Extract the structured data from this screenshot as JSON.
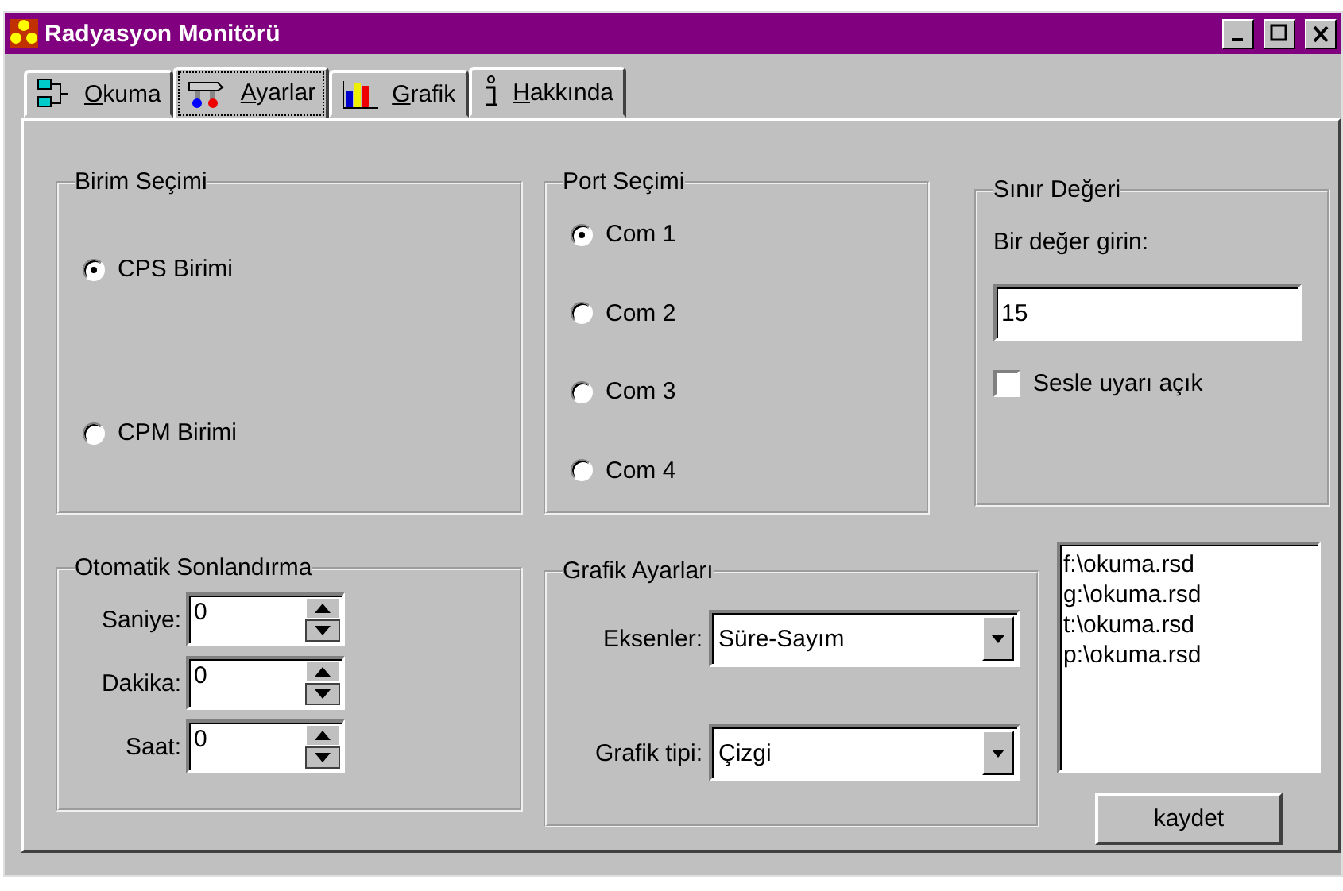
{
  "window": {
    "title": "Radyasyon Monitörü"
  },
  "tabs": [
    {
      "label": "Okuma",
      "selected": false,
      "kind": "reading"
    },
    {
      "label": "Ayarlar",
      "selected": true,
      "kind": "settings"
    },
    {
      "label": "Grafik",
      "selected": false,
      "kind": "chart"
    },
    {
      "label": "Hakkında",
      "selected": false,
      "kind": "info"
    }
  ],
  "unit_group": {
    "title": "Birim Seçimi",
    "options": [
      {
        "label": "CPS Birimi",
        "selected": true
      },
      {
        "label": "CPM Birimi",
        "selected": false
      }
    ]
  },
  "port_group": {
    "title": "Port Seçimi",
    "options": [
      {
        "label": "Com 1",
        "selected": true
      },
      {
        "label": "Com 2",
        "selected": false
      },
      {
        "label": "Com 3",
        "selected": false
      },
      {
        "label": "Com 4",
        "selected": false
      }
    ]
  },
  "limit_group": {
    "title": "Sınır Değeri",
    "prompt": "Bir değer girin:",
    "value": "15",
    "alarm": {
      "label": "Sesle uyarı açık",
      "checked": false
    }
  },
  "auto_stop_group": {
    "title": "Otomatik Sonlandırma",
    "fields": [
      {
        "label": "Saniye:",
        "value": "0"
      },
      {
        "label": "Dakika:",
        "value": "0"
      },
      {
        "label": "Saat:",
        "value": "0"
      }
    ]
  },
  "graph_group": {
    "title": "Grafik Ayarları",
    "fields": [
      {
        "label": "Eksenler:",
        "value": "Süre-Sayım"
      },
      {
        "label": "Grafik tipi:",
        "value": "Çizgi"
      }
    ]
  },
  "file_list": [
    "f:\\okuma.rsd",
    "g:\\okuma.rsd",
    "t:\\okuma.rsd",
    "p:\\okuma.rsd"
  ],
  "save_button": "kaydet"
}
